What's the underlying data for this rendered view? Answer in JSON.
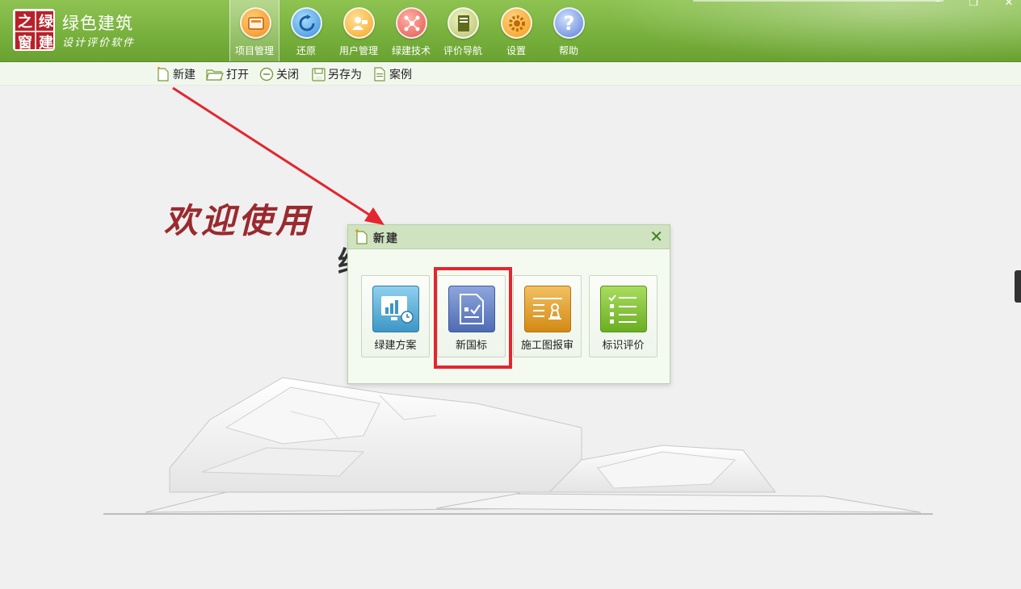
{
  "app": {
    "logo_chars": [
      "之",
      "绿",
      "窗",
      "建"
    ],
    "name": "绿色建筑",
    "subtitle": "设计评价软件"
  },
  "toolbar": [
    {
      "label": "项目管理",
      "icon": "project-icon",
      "color": "#f08a1e",
      "active": true
    },
    {
      "label": "还原",
      "icon": "restore-icon",
      "color": "#3b8fd9"
    },
    {
      "label": "用户管理",
      "icon": "user-icon",
      "color": "#f5a623"
    },
    {
      "label": "绿建技术",
      "icon": "tech-icon",
      "color": "#e2574c"
    },
    {
      "label": "评价导航",
      "icon": "guide-book-icon",
      "color": "#8a9a3a"
    },
    {
      "label": "设置",
      "icon": "gear-icon",
      "color": "#f39c12"
    },
    {
      "label": "帮助",
      "icon": "help-icon",
      "color": "#5b7fd6"
    }
  ],
  "window_controls": {
    "minimize": "–",
    "restore": "❐",
    "close": "✕"
  },
  "subtoolbar": [
    {
      "label": "新建",
      "icon": "new-file-icon"
    },
    {
      "label": "打开",
      "icon": "open-folder-icon"
    },
    {
      "label": "关闭",
      "icon": "close-circle-icon"
    },
    {
      "label": "另存为",
      "icon": "save-as-icon"
    },
    {
      "label": "案例",
      "icon": "case-document-icon"
    }
  ],
  "welcome": {
    "text": "欢迎使用",
    "partial_char": "绿"
  },
  "dialog": {
    "title": "新建",
    "close": "✕",
    "tiles": [
      {
        "label": "绿建方案",
        "icon": "chart-monitor-icon",
        "color": "#4aa6d1"
      },
      {
        "label": "新国标",
        "icon": "checked-document-icon",
        "color": "#5b78bf"
      },
      {
        "label": "施工图报审",
        "icon": "stamp-icon",
        "color": "#e09a1f"
      },
      {
        "label": "标识评价",
        "icon": "checklist-icon",
        "color": "#7bbf2d"
      }
    ]
  }
}
